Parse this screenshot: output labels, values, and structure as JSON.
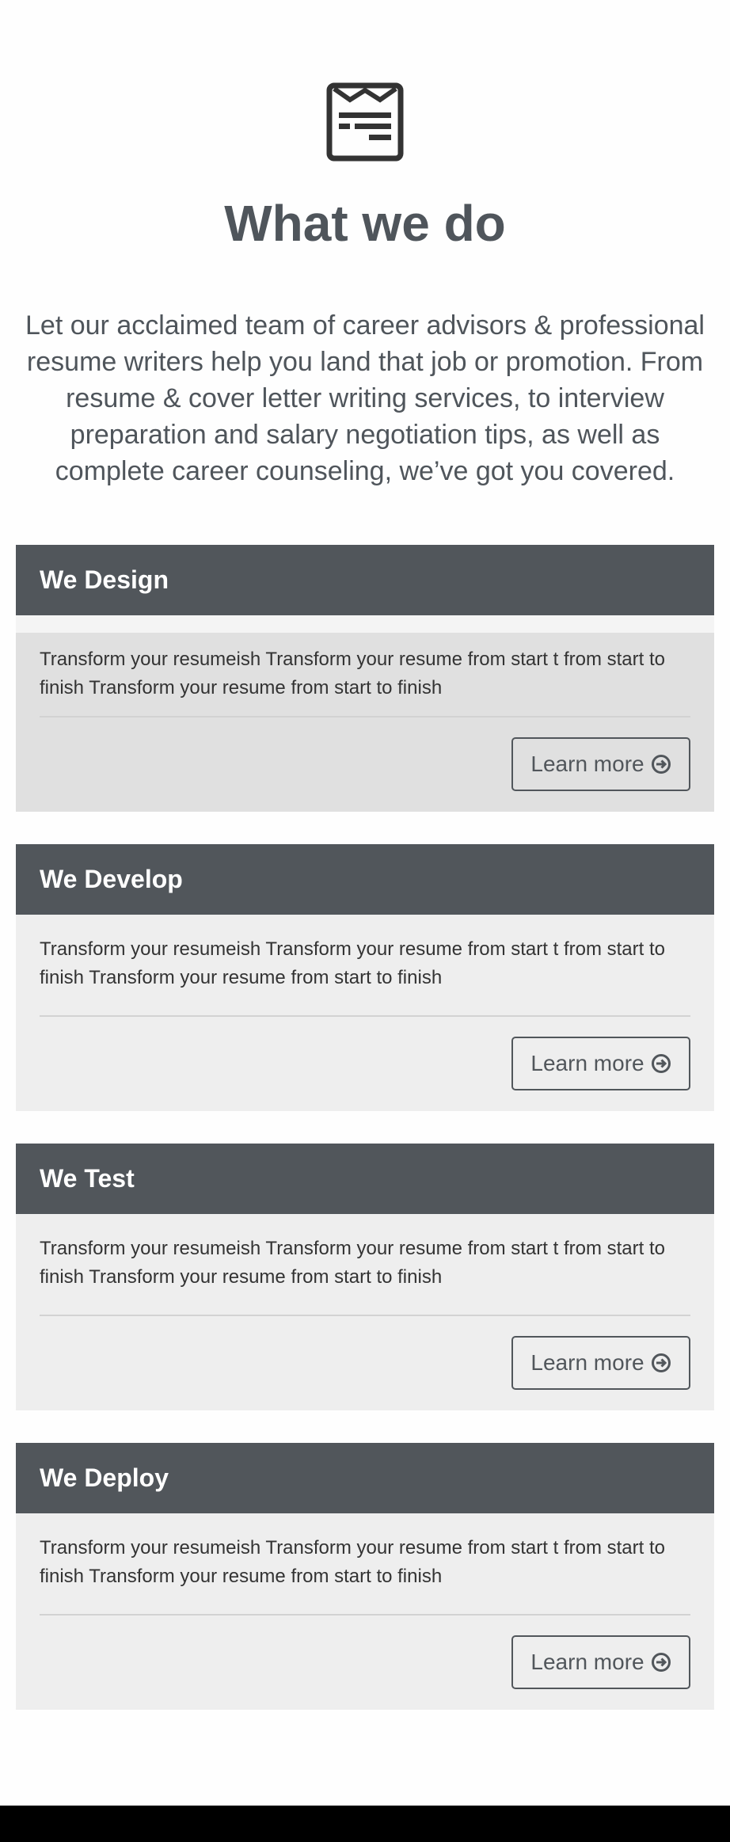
{
  "hero": {
    "title": "What we do",
    "intro": "Let our acclaimed team of career advisors & professional resume writers help you land that job or promotion. From resume & cover letter writing services, to interview preparation and salary negotiation tips, as well as complete career counseling, we’ve got you covered.",
    "icon": "resume-document-icon"
  },
  "cards": [
    {
      "title": "We Design",
      "body": "Transform your resumeish Transform your resume from start t from start to finish Transform your resume from start to finish",
      "button_label": "Learn more"
    },
    {
      "title": "We Develop",
      "body": "Transform your resumeish Transform your resume from start t from start to finish Transform your resume from start to finish",
      "button_label": "Learn more"
    },
    {
      "title": "We Test",
      "body": "Transform your resumeish Transform your resume from start t from start to finish Transform your resume from start to finish",
      "button_label": "Learn more"
    },
    {
      "title": "We Deploy",
      "body": "Transform your resumeish Transform your resume from start t from start to finish Transform your resume from start to finish",
      "button_label": "Learn more"
    }
  ],
  "colors": {
    "header_bg": "#51565b",
    "card_bg": "#eeeeee",
    "text": "#4f555b"
  }
}
